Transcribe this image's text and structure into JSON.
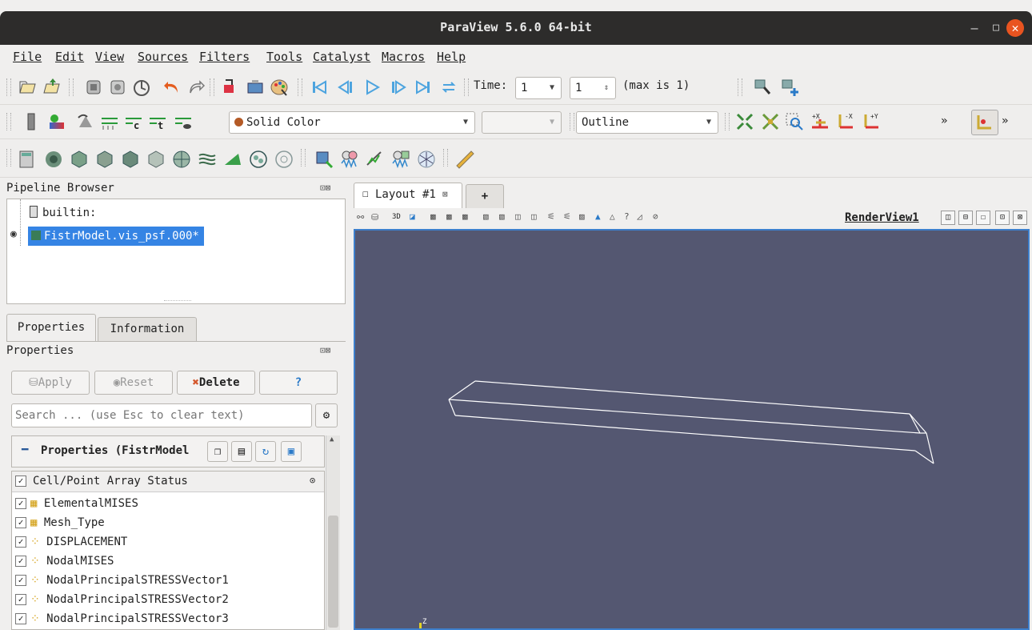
{
  "window": {
    "title": "ParaView 5.6.0 64-bit",
    "minimize": "–",
    "maximize": "□",
    "close": "✕"
  },
  "menu": [
    "File",
    "Edit",
    "View",
    "Sources",
    "Filters",
    "Tools",
    "Catalyst",
    "Macros",
    "Help"
  ],
  "time_bar": {
    "label": "Time:",
    "time_value": "1",
    "step_value": "1",
    "max_label": "(max is 1)"
  },
  "display_bar": {
    "coloring": "Solid Color",
    "component": "",
    "representation": "Outline",
    "more": "»"
  },
  "pipeline": {
    "title": "Pipeline Browser",
    "root": "builtin:",
    "items": [
      {
        "label": "FistrModel.vis_psf.000*",
        "selected": true,
        "visible": true
      }
    ]
  },
  "tabs": {
    "properties": "Properties",
    "information": "Information"
  },
  "properties": {
    "title": "Properties",
    "apply": "Apply",
    "reset": "Reset",
    "delete": "Delete",
    "help": "?",
    "search_placeholder": "Search ... (use Esc to clear text)",
    "section": "Properties (FistrModel",
    "array_header": "Cell/Point Array Status",
    "arrays": [
      {
        "name": "ElementalMISES",
        "type": "cell",
        "checked": true
      },
      {
        "name": "Mesh_Type",
        "type": "cell",
        "checked": true
      },
      {
        "name": "DISPLACEMENT",
        "type": "point",
        "checked": true
      },
      {
        "name": "NodalMISES",
        "type": "point",
        "checked": true
      },
      {
        "name": "NodalPrincipalSTRESSVector1",
        "type": "point",
        "checked": true
      },
      {
        "name": "NodalPrincipalSTRESSVector2",
        "type": "point",
        "checked": true
      },
      {
        "name": "NodalPrincipalSTRESSVector3",
        "type": "point",
        "checked": true
      }
    ]
  },
  "layout": {
    "tab": "Layout #1",
    "add": "+",
    "render_view": "RenderView1",
    "view_3d": "3D",
    "axis_label": "Z"
  },
  "colors": {
    "accent": "#3d7fcc",
    "viewport": "#545771",
    "titlebar": "#2d2c2b",
    "close": "#e95420",
    "selection": "#3584e4"
  }
}
